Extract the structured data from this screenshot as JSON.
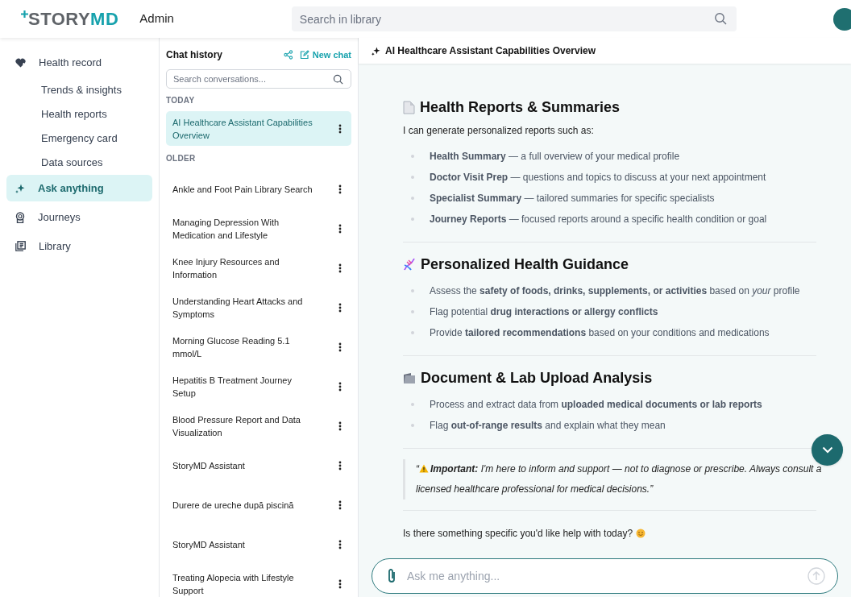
{
  "header": {
    "logo": {
      "part_1": "STORY",
      "part_2": "MD"
    },
    "role": "Admin",
    "search": {
      "placeholder": "Search in library"
    }
  },
  "sidebar": {
    "items": [
      {
        "label": "Health record",
        "selected": false,
        "children": [
          {
            "label": "Trends & insights",
            "selected": false
          },
          {
            "label": "Health reports",
            "selected": false
          },
          {
            "label": "Emergency card",
            "selected": false
          },
          {
            "label": "Data sources",
            "selected": false
          }
        ]
      },
      {
        "label": "Ask anything",
        "selected": true
      },
      {
        "label": "Journeys",
        "selected": false
      },
      {
        "label": "Library",
        "selected": false
      }
    ]
  },
  "chat_history": {
    "title": "Chat history",
    "new_chat": "New chat",
    "search": {
      "placeholder": "Search conversations..."
    },
    "groups": [
      {
        "label": "TODAY",
        "items": [
          {
            "title": "AI Healthcare Assistant Capabilities Overview",
            "selected": true
          }
        ]
      },
      {
        "label": "OLDER",
        "items": [
          {
            "title": "Ankle and Foot Pain Library Search",
            "selected": false
          },
          {
            "title": "Managing Depression With Medication and Lifestyle",
            "selected": false
          },
          {
            "title": "Knee Injury Resources and Information",
            "selected": false
          },
          {
            "title": "Understanding Heart Attacks and Symptoms",
            "selected": false
          },
          {
            "title": "Morning Glucose Reading 5.1 mmol/L",
            "selected": false
          },
          {
            "title": "Hepatitis B Treatment Journey Setup",
            "selected": false
          },
          {
            "title": "Blood Pressure Report and Data Visualization",
            "selected": false
          },
          {
            "title": "StoryMD Assistant",
            "selected": false
          },
          {
            "title": "Durere de ureche după piscină",
            "selected": false
          },
          {
            "title": "StoryMD Assistant",
            "selected": false
          },
          {
            "title": "Treating Alopecia with Lifestyle Support",
            "selected": false
          }
        ]
      }
    ]
  },
  "conversation": {
    "title": "AI Healthcare Assistant Capabilities Overview",
    "blocks": [
      {
        "kind": "heading",
        "text": "Health Reports & Summaries"
      },
      {
        "kind": "paragraph",
        "text": "I can generate personalized reports such as:"
      },
      {
        "kind": "list",
        "items": [
          "**Health Summary** — a full overview of your medical profile",
          "**Doctor Visit Prep** — questions and topics to discuss at your next appointment",
          "**Specialist Summary** — tailored summaries for specific specialists",
          "**Journey Reports** — focused reports around a specific health condition or goal"
        ]
      },
      {
        "kind": "divider"
      },
      {
        "kind": "heading",
        "text": "Personalized Health Guidance"
      },
      {
        "kind": "list",
        "items": [
          "Assess the **safety of foods, drinks, supplements, or activities** based on *your* profile",
          "Flag potential **drug interactions or allergy conflicts**",
          "Provide **tailored recommendations** based on your conditions and medications"
        ]
      },
      {
        "kind": "divider"
      },
      {
        "kind": "heading",
        "text": "Document & Lab Upload Analysis"
      },
      {
        "kind": "list",
        "items": [
          "Process and extract data from **uploaded medical documents or lab reports**",
          "Flag **out-of-range results** and explain what they mean"
        ]
      },
      {
        "kind": "divider"
      },
      {
        "kind": "quote",
        "open": "“",
        "text": "**Important:** I'm here to inform and support — not to diagnose or prescribe. Always consult a licensed healthcare professional for medical decisions.”"
      },
      {
        "kind": "divider"
      },
      {
        "kind": "closing",
        "text": "Is there something specific you'd like help with today?"
      }
    ],
    "input": {
      "placeholder": "Ask me anything..."
    }
  }
}
